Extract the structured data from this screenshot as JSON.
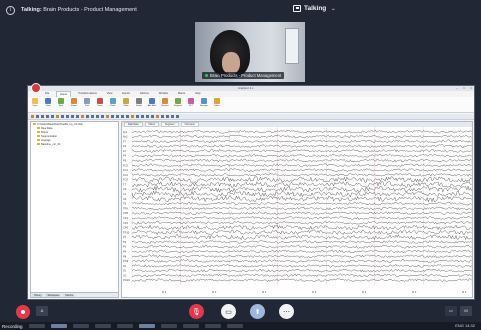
{
  "meeting": {
    "title_bold": "Talking:",
    "title_rest": " Brain Products - Product Management",
    "status_label": "Talking",
    "participant_label": "Brain Products - Product Management"
  },
  "app": {
    "title": "Analyzer 2.x",
    "tabs": [
      "File",
      "Home",
      "Transformations",
      "View",
      "Export",
      "Add-Ins",
      "Window",
      "Macro",
      "Help"
    ],
    "ribbon_buttons": [
      "Open",
      "Close",
      "Save",
      "Export",
      "Print",
      "Undo",
      "Redo",
      "Show",
      "Details",
      "Add Mark",
      "Markers",
      "Segment",
      "FFT",
      "Average",
      "Filters"
    ],
    "ribbon_colors": [
      "#f0c04c",
      "#4f79c9",
      "#6ea84d",
      "#d98b3c",
      "#8a9cc0",
      "#d14a4a",
      "#59a0cf",
      "#c9a93f",
      "#7d7d7d",
      "#4f79c9",
      "#d98b3c",
      "#6ea84d",
      "#c55fa0",
      "#5a8fd1",
      "#e0a52f"
    ],
    "tree": [
      "C:\\Vision\\Raw\\Files\\Testfile_bp_01.vhdr",
      "Raw Data",
      "Filters",
      "Segmentation",
      "Average",
      "Baseline_cor_01"
    ],
    "tree_tabs": [
      "History",
      "Workspace",
      "Macros"
    ],
    "eeg_tabs": [
      "Raw Data",
      "Filters",
      "Segment",
      "Overview"
    ],
    "channels": [
      "Fp1",
      "Fp2",
      "F7",
      "F3",
      "Fz",
      "F4",
      "F8",
      "FC5",
      "FC1",
      "FC2",
      "FC6",
      "T7",
      "C3",
      "Cz",
      "C4",
      "T8",
      "TP9",
      "CP5",
      "CP1",
      "CP2",
      "CP6",
      "TP10",
      "P7",
      "P3",
      "Pz",
      "P4",
      "P8",
      "PO9",
      "O1",
      "Oz",
      "O2",
      "PO10"
    ],
    "markers": [
      "S 1",
      "S 1",
      "S 1",
      "S 1",
      "S 1",
      "S 1",
      "S 1"
    ]
  },
  "controls": {
    "recording_label": "Recording",
    "mic_icon": "mic-off-icon",
    "camera_icon": "camera-icon",
    "share_icon": "screen-share-icon",
    "more_icon": "more-options-icon",
    "leave_icon": "leave-call-icon",
    "side_left": "A",
    "side_right": "M"
  },
  "taskbar": {
    "tray_time": "ENG  14:32"
  }
}
